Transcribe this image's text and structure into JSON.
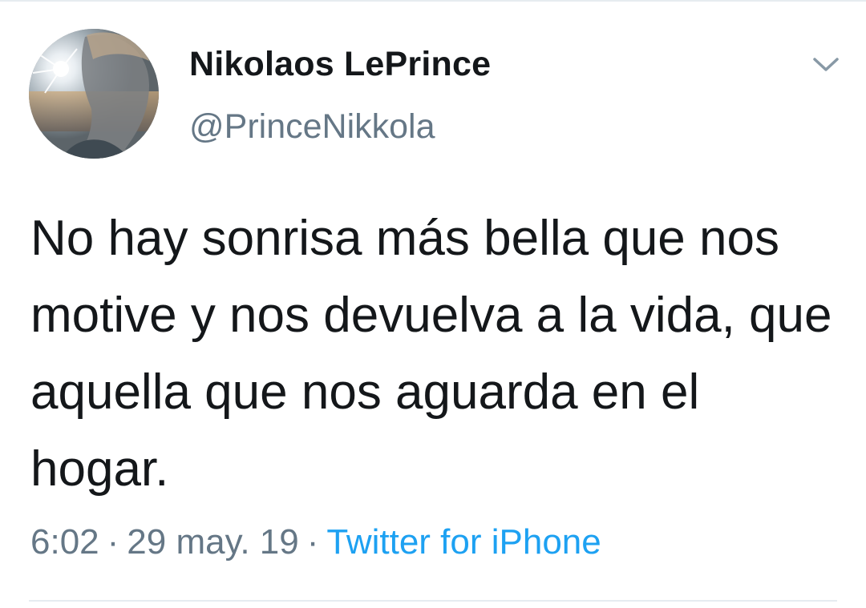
{
  "tweet": {
    "author": {
      "display_name": "Nikolaos LePrince",
      "handle": "@PrinceNikkola"
    },
    "text": "No hay sonrisa más bella que nos motive y nos devuelva a la vida, que aquella que nos aguarda en el hogar.",
    "time": "6:02",
    "separator": "·",
    "date": "29 may. 19",
    "source": "Twitter for iPhone"
  },
  "icons": {
    "menu": "chevron-down-icon"
  },
  "colors": {
    "primary_text": "#14171a",
    "secondary_text": "#657786",
    "link": "#1da1f2",
    "divider": "#e6ecf0"
  }
}
